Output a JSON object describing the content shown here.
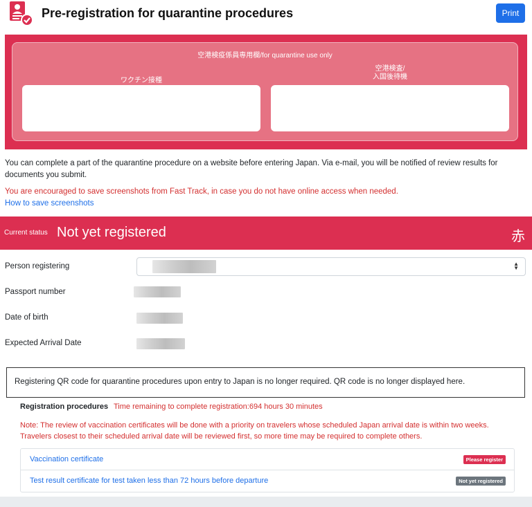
{
  "header": {
    "title": "Pre-registration for quarantine procedures",
    "print_label": "Print",
    "logo_icon": "document-check-icon"
  },
  "quarantine_panel": {
    "title": "空港検疫係員専用欄/for quarantine use only",
    "left_label": "ワクチン接種",
    "right_label_line1": "空港検査/",
    "right_label_line2": "入国後待機"
  },
  "intro": {
    "text": "You can complete a part of the quarantine procedure on a website before entering Japan. Via e-mail, you will be notified of review results for documents you submit.",
    "warning": "You are encouraged to save screenshots from Fast Track, in case you do not have online access when needed.",
    "link": "How to save screenshots"
  },
  "status": {
    "label": "Current status",
    "value": "Not yet registered",
    "kanji": "赤"
  },
  "fields": {
    "person_label": "Person registering",
    "passport_label": "Passport number",
    "dob_label": "Date of birth",
    "arrival_label": "Expected Arrival Date"
  },
  "qr_notice": "Registering QR code for quarantine procedures upon entry to Japan is no longer required. QR code is no longer displayed here.",
  "registration": {
    "title": "Registration procedures",
    "remaining": "Time remaining to complete registration:694 hours 30 minutes",
    "note_line1": "Note: The review of vaccination certificates will be done with a priority on travelers whose scheduled Japan arrival date is within two weeks.",
    "note_line2": "Travelers closest to their scheduled arrival date will be reviewed first, so more time may be required to complete others.",
    "items": [
      {
        "label": "Vaccination certificate",
        "badge": "Please register"
      },
      {
        "label": "Test result certificate for test taken less than 72 hours before departure",
        "badge": "Not yet registered"
      }
    ]
  },
  "colors": {
    "accent_red": "#dc2f51",
    "link_blue": "#1e6fe8",
    "warning_red": "#d32f2f"
  }
}
